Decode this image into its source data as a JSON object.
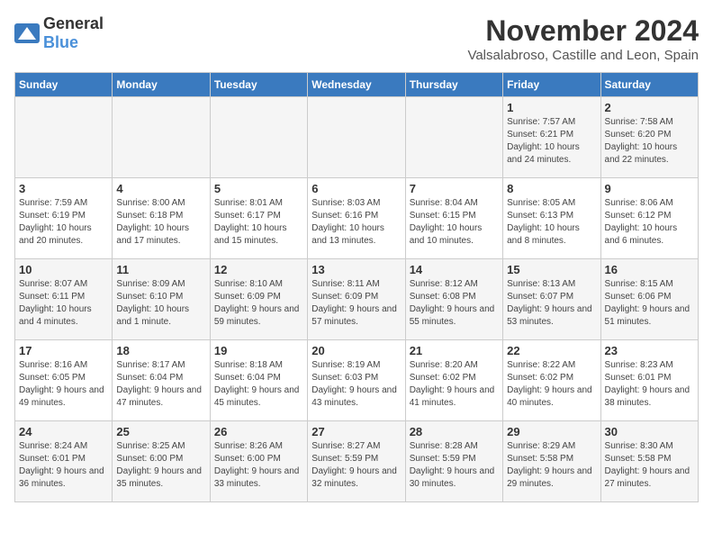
{
  "logo": {
    "general": "General",
    "blue": "Blue"
  },
  "title": "November 2024",
  "subtitle": "Valsalabroso, Castille and Leon, Spain",
  "days_of_week": [
    "Sunday",
    "Monday",
    "Tuesday",
    "Wednesday",
    "Thursday",
    "Friday",
    "Saturday"
  ],
  "weeks": [
    [
      {
        "day": "",
        "info": ""
      },
      {
        "day": "",
        "info": ""
      },
      {
        "day": "",
        "info": ""
      },
      {
        "day": "",
        "info": ""
      },
      {
        "day": "",
        "info": ""
      },
      {
        "day": "1",
        "info": "Sunrise: 7:57 AM\nSunset: 6:21 PM\nDaylight: 10 hours and 24 minutes."
      },
      {
        "day": "2",
        "info": "Sunrise: 7:58 AM\nSunset: 6:20 PM\nDaylight: 10 hours and 22 minutes."
      }
    ],
    [
      {
        "day": "3",
        "info": "Sunrise: 7:59 AM\nSunset: 6:19 PM\nDaylight: 10 hours and 20 minutes."
      },
      {
        "day": "4",
        "info": "Sunrise: 8:00 AM\nSunset: 6:18 PM\nDaylight: 10 hours and 17 minutes."
      },
      {
        "day": "5",
        "info": "Sunrise: 8:01 AM\nSunset: 6:17 PM\nDaylight: 10 hours and 15 minutes."
      },
      {
        "day": "6",
        "info": "Sunrise: 8:03 AM\nSunset: 6:16 PM\nDaylight: 10 hours and 13 minutes."
      },
      {
        "day": "7",
        "info": "Sunrise: 8:04 AM\nSunset: 6:15 PM\nDaylight: 10 hours and 10 minutes."
      },
      {
        "day": "8",
        "info": "Sunrise: 8:05 AM\nSunset: 6:13 PM\nDaylight: 10 hours and 8 minutes."
      },
      {
        "day": "9",
        "info": "Sunrise: 8:06 AM\nSunset: 6:12 PM\nDaylight: 10 hours and 6 minutes."
      }
    ],
    [
      {
        "day": "10",
        "info": "Sunrise: 8:07 AM\nSunset: 6:11 PM\nDaylight: 10 hours and 4 minutes."
      },
      {
        "day": "11",
        "info": "Sunrise: 8:09 AM\nSunset: 6:10 PM\nDaylight: 10 hours and 1 minute."
      },
      {
        "day": "12",
        "info": "Sunrise: 8:10 AM\nSunset: 6:09 PM\nDaylight: 9 hours and 59 minutes."
      },
      {
        "day": "13",
        "info": "Sunrise: 8:11 AM\nSunset: 6:09 PM\nDaylight: 9 hours and 57 minutes."
      },
      {
        "day": "14",
        "info": "Sunrise: 8:12 AM\nSunset: 6:08 PM\nDaylight: 9 hours and 55 minutes."
      },
      {
        "day": "15",
        "info": "Sunrise: 8:13 AM\nSunset: 6:07 PM\nDaylight: 9 hours and 53 minutes."
      },
      {
        "day": "16",
        "info": "Sunrise: 8:15 AM\nSunset: 6:06 PM\nDaylight: 9 hours and 51 minutes."
      }
    ],
    [
      {
        "day": "17",
        "info": "Sunrise: 8:16 AM\nSunset: 6:05 PM\nDaylight: 9 hours and 49 minutes."
      },
      {
        "day": "18",
        "info": "Sunrise: 8:17 AM\nSunset: 6:04 PM\nDaylight: 9 hours and 47 minutes."
      },
      {
        "day": "19",
        "info": "Sunrise: 8:18 AM\nSunset: 6:04 PM\nDaylight: 9 hours and 45 minutes."
      },
      {
        "day": "20",
        "info": "Sunrise: 8:19 AM\nSunset: 6:03 PM\nDaylight: 9 hours and 43 minutes."
      },
      {
        "day": "21",
        "info": "Sunrise: 8:20 AM\nSunset: 6:02 PM\nDaylight: 9 hours and 41 minutes."
      },
      {
        "day": "22",
        "info": "Sunrise: 8:22 AM\nSunset: 6:02 PM\nDaylight: 9 hours and 40 minutes."
      },
      {
        "day": "23",
        "info": "Sunrise: 8:23 AM\nSunset: 6:01 PM\nDaylight: 9 hours and 38 minutes."
      }
    ],
    [
      {
        "day": "24",
        "info": "Sunrise: 8:24 AM\nSunset: 6:01 PM\nDaylight: 9 hours and 36 minutes."
      },
      {
        "day": "25",
        "info": "Sunrise: 8:25 AM\nSunset: 6:00 PM\nDaylight: 9 hours and 35 minutes."
      },
      {
        "day": "26",
        "info": "Sunrise: 8:26 AM\nSunset: 6:00 PM\nDaylight: 9 hours and 33 minutes."
      },
      {
        "day": "27",
        "info": "Sunrise: 8:27 AM\nSunset: 5:59 PM\nDaylight: 9 hours and 32 minutes."
      },
      {
        "day": "28",
        "info": "Sunrise: 8:28 AM\nSunset: 5:59 PM\nDaylight: 9 hours and 30 minutes."
      },
      {
        "day": "29",
        "info": "Sunrise: 8:29 AM\nSunset: 5:58 PM\nDaylight: 9 hours and 29 minutes."
      },
      {
        "day": "30",
        "info": "Sunrise: 8:30 AM\nSunset: 5:58 PM\nDaylight: 9 hours and 27 minutes."
      }
    ]
  ]
}
